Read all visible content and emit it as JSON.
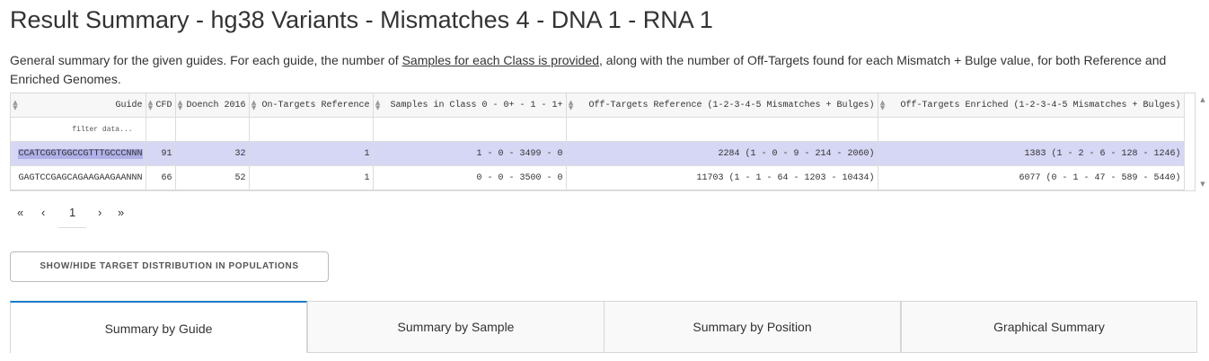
{
  "header": {
    "title": "Result Summary - hg38 Variants - Mismatches 4 - DNA 1 - RNA 1"
  },
  "description": {
    "before_link": "General summary for the given guides. For each guide, the number of ",
    "link": "Samples for each Class is provided",
    "after_link": ", along with the number of Off-Targets found for each Mismatch + Bulge value, for both Reference and Enriched Genomes."
  },
  "table": {
    "columns": [
      "Guide",
      "CFD",
      "Doench 2016",
      "On-Targets Reference",
      "Samples in Class 0 - 0+ - 1 - 1+",
      "Off-Targets Reference (1-2-3-4-5 Mismatches + Bulges)",
      "Off-Targets Enriched (1-2-3-4-5 Mismatches + Bulges)"
    ],
    "filter_placeholder": "filter data...",
    "rows": [
      [
        "CCATCGGTGGCCGTTTGCCCNNN",
        "91",
        "32",
        "1",
        "1 - 0 - 3499 - 0",
        "2284 (1 - 0 - 9 - 214 - 2060)",
        "1383 (1 - 2 - 6 - 128 - 1246)"
      ],
      [
        "GAGTCCGAGCAGAAGAAGAANNN",
        "66",
        "52",
        "1",
        "0 - 0 - 3500 - 0",
        "11703 (1 - 1 - 64 - 1203 - 10434)",
        "6077 (0 - 1 - 47 - 589 - 5440)"
      ]
    ]
  },
  "pager": {
    "first": "«",
    "prev": "‹",
    "current": "1",
    "next": "›",
    "last": "»"
  },
  "toggle_button": {
    "label": "SHOW/HIDE TARGET DISTRIBUTION IN POPULATIONS"
  },
  "tabs": [
    {
      "label": "Summary by Guide",
      "active": true
    },
    {
      "label": "Summary by Sample",
      "active": false
    },
    {
      "label": "Summary by Position",
      "active": false
    },
    {
      "label": "Graphical Summary",
      "active": false
    }
  ],
  "icons": {
    "sort": "sort-arrows-icon",
    "scroll_up": "scroll-up-icon",
    "scroll_down": "scroll-down-icon"
  }
}
